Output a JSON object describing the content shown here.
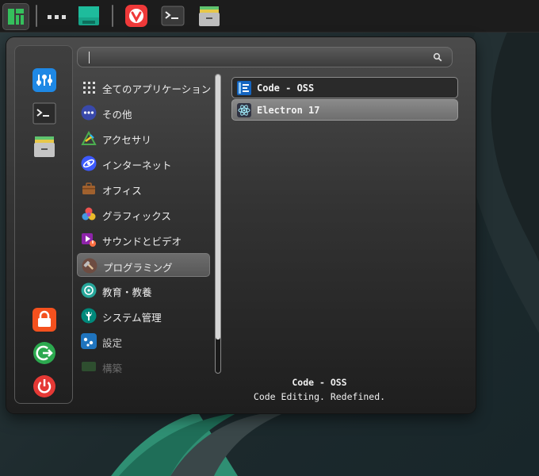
{
  "taskbar": {
    "launchers": [
      {
        "name": "manjaro-logo-icon"
      },
      {
        "name": "window-list-icon"
      },
      {
        "name": "files-green-icon"
      },
      {
        "name": "vivaldi-browser-icon"
      },
      {
        "name": "terminal-icon"
      },
      {
        "name": "file-cabinet-icon"
      }
    ]
  },
  "menu": {
    "search": {
      "value": "",
      "placeholder": ""
    },
    "favorites": [
      {
        "name": "settings-manager-icon"
      },
      {
        "name": "terminal-icon"
      },
      {
        "name": "file-manager-icon"
      },
      {
        "name": "lock-icon"
      },
      {
        "name": "logout-icon"
      },
      {
        "name": "power-icon"
      }
    ],
    "categories": [
      {
        "label": "全てのアプリケーション",
        "icon": "grid-icon"
      },
      {
        "label": "その他",
        "icon": "more-icon"
      },
      {
        "label": "アクセサリ",
        "icon": "accessories-icon"
      },
      {
        "label": "インターネット",
        "icon": "internet-icon"
      },
      {
        "label": "オフィス",
        "icon": "office-icon"
      },
      {
        "label": "グラフィックス",
        "icon": "graphics-icon"
      },
      {
        "label": "サウンドとビデオ",
        "icon": "multimedia-icon"
      },
      {
        "label": "プログラミング",
        "icon": "programming-icon"
      },
      {
        "label": "教育・教養",
        "icon": "education-icon"
      },
      {
        "label": "システム管理",
        "icon": "system-icon"
      },
      {
        "label": "設定",
        "icon": "settings-icon"
      },
      {
        "label": "構築",
        "icon": "build-icon"
      }
    ],
    "selected_category": "プログラミング",
    "apps": [
      {
        "label": "Code - OSS",
        "icon": "vscode-icon"
      },
      {
        "label": "Electron 17",
        "icon": "electron-icon"
      }
    ],
    "info": {
      "title": "Code - OSS",
      "description": "Code Editing. Redefined."
    }
  }
}
